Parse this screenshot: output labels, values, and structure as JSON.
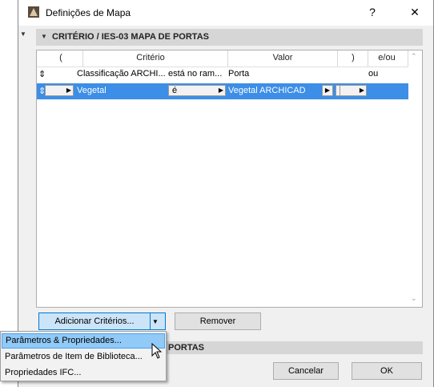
{
  "window": {
    "title": "Definições de Mapa",
    "help": "?",
    "close": "✕"
  },
  "section1": {
    "title": "CRITÉRIO / IES-03 MAPA DE PORTAS"
  },
  "table": {
    "headers": [
      "(",
      "Critério",
      "Valor",
      ")",
      "e/ou"
    ],
    "rows": [
      {
        "handle": "⇕",
        "open_paren": "",
        "criterion": "Classificação ARCHI...",
        "operator": "está no ram...",
        "value": "Porta",
        "close_paren": "",
        "and_or": "ou"
      },
      {
        "handle": "⇕",
        "open_paren": "",
        "criterion": "Vegetal",
        "operator": "é",
        "value": "Vegetal ARCHICAD",
        "close_paren": "",
        "and_or": ""
      }
    ]
  },
  "buttons": {
    "add_criteria": "Adicionar Critérios...",
    "remove": "Remover",
    "cancel": "Cancelar",
    "ok": "OK"
  },
  "section2": {
    "title": "PORTAS"
  },
  "menu": {
    "items": [
      "Parâmetros & Propriedades...",
      "Parâmetros de Item de Biblioteca...",
      "Propriedades IFC..."
    ]
  },
  "colors": {
    "selection": "#3c8ee6",
    "menu_hover": "#91c9f7",
    "section_header": "#d6d6d6"
  }
}
